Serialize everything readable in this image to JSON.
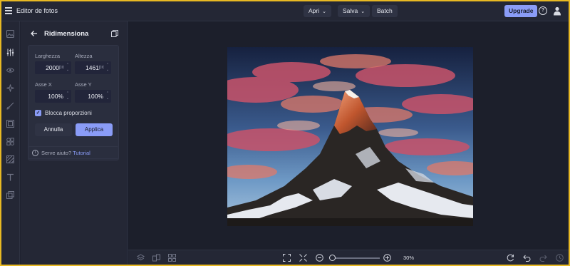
{
  "header": {
    "app_title": "Editor de fotos",
    "open_label": "Apri",
    "save_label": "Salva",
    "batch_label": "Batch",
    "upgrade_label": "Upgrade",
    "help_glyph": "?"
  },
  "rail": {
    "icons": [
      "image-icon",
      "sliders-icon",
      "eye-icon",
      "sparkle-icon",
      "brush-icon",
      "frame-icon",
      "shapes-icon",
      "texture-icon",
      "text-icon",
      "layers-icon"
    ]
  },
  "panel": {
    "title": "Ridimensiona",
    "width_label": "Larghezza",
    "width_value": "2000",
    "width_unit": "px",
    "height_label": "Altezza",
    "height_value": "1461",
    "height_unit": "px",
    "scale_x_label": "Asse X",
    "scale_x_value": "100%",
    "scale_y_label": "Asse Y",
    "scale_y_value": "100%",
    "lock_label": "Blocca proporzioni",
    "lock_checked": true,
    "cancel_label": "Annulla",
    "apply_label": "Applica",
    "help_text": "Serve aiuto?",
    "help_link": "Tutorial"
  },
  "bottom": {
    "zoom_percent_label": "30%",
    "zoom_level": 0.3
  },
  "colors": {
    "accent": "#8a9cf7",
    "background": "#1f2230",
    "panel": "#242735",
    "frame_border": "#e8b923"
  }
}
